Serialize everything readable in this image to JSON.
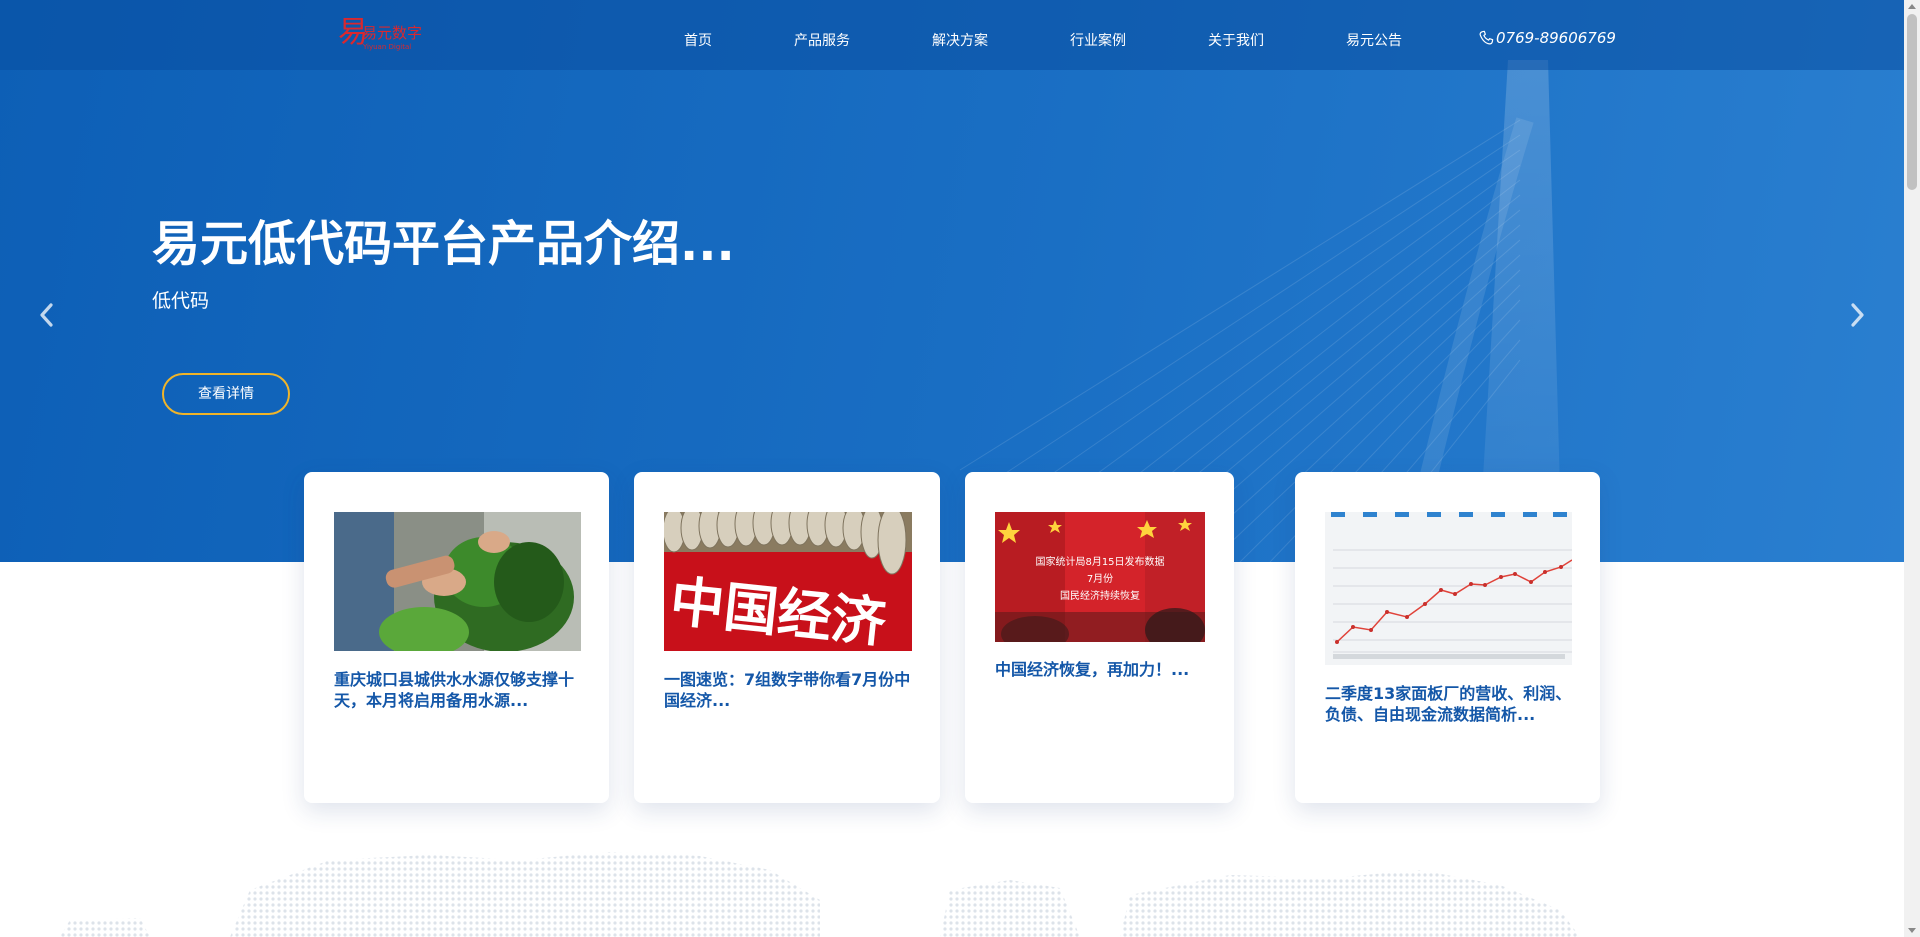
{
  "header": {
    "logo": {
      "mark": "易",
      "name": "易元数字",
      "sub": "Yiyuan Digital"
    },
    "nav": [
      {
        "label": "首页"
      },
      {
        "label": "产品服务"
      },
      {
        "label": "解决方案"
      },
      {
        "label": "行业案例"
      },
      {
        "label": "关于我们"
      },
      {
        "label": "易元公告"
      }
    ],
    "phone": "0769-89606769"
  },
  "hero": {
    "title": "易元低代码平台产品介绍...",
    "subtitle": "低代码",
    "button_label": "查看详情",
    "prev_icon": "chevron-left-icon",
    "next_icon": "chevron-right-icon"
  },
  "cards": [
    {
      "title": "重庆城口县城供水水源仅够支撑十天，本月将启用备用水源...",
      "image": "vegetables-washing"
    },
    {
      "title": "一图速览：7组数字带你看7月份中国经济...",
      "image": "china-economy-coins",
      "image_text": "中国经济"
    },
    {
      "title": "中国经济恢复，再加力！...",
      "image": "flags-statistics",
      "image_text": [
        "国家统计局8月15日发布数据",
        "7月份",
        "国民经济持续恢复"
      ]
    },
    {
      "title": "二季度13家面板厂的营收、利润、负债、自由现金流数据简析...",
      "image": "line-chart"
    }
  ],
  "colors": {
    "hero_blue": "#1a6fc4",
    "card_title": "#1457a8",
    "button_border": "#f0b429",
    "logo_red": "#d9282f"
  }
}
